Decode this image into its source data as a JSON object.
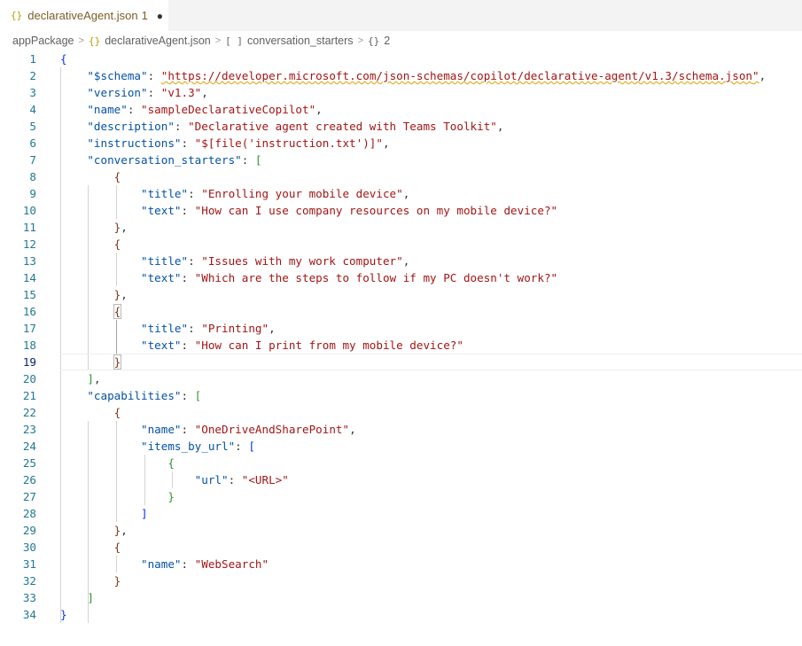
{
  "tab": {
    "icon": "{}",
    "filename": "declarativeAgent.json",
    "problem_count": "1",
    "modified_indicator": "●"
  },
  "breadcrumb": [
    {
      "icon": "",
      "label": "appPackage"
    },
    {
      "icon": "{}",
      "label": "declarativeAgent.json"
    },
    {
      "icon": "[ ]",
      "label": "conversation_starters"
    },
    {
      "icon": "{}",
      "label": "2"
    }
  ],
  "editor": {
    "current_line": 19,
    "lines": [
      {
        "n": "1",
        "t": [
          {
            "c": "b1",
            "v": "{"
          }
        ]
      },
      {
        "n": "2",
        "t": [
          {
            "c": "p",
            "v": "    "
          },
          {
            "c": "k",
            "v": "\"$schema\""
          },
          {
            "c": "p",
            "v": ": "
          },
          {
            "c": "s squig",
            "v": "\""
          },
          {
            "c": "s link squig",
            "v": "https://developer.microsoft.com/json-schemas/copilot/declarative-agent/v1.3/schema.json"
          },
          {
            "c": "s squig",
            "v": "\""
          },
          {
            "c": "p",
            "v": ","
          }
        ]
      },
      {
        "n": "3",
        "t": [
          {
            "c": "p",
            "v": "    "
          },
          {
            "c": "k",
            "v": "\"version\""
          },
          {
            "c": "p",
            "v": ": "
          },
          {
            "c": "s",
            "v": "\"v1.3\""
          },
          {
            "c": "p",
            "v": ","
          }
        ]
      },
      {
        "n": "4",
        "t": [
          {
            "c": "p",
            "v": "    "
          },
          {
            "c": "k",
            "v": "\"name\""
          },
          {
            "c": "p",
            "v": ": "
          },
          {
            "c": "s",
            "v": "\"sampleDeclarativeCopilot\""
          },
          {
            "c": "p",
            "v": ","
          }
        ]
      },
      {
        "n": "5",
        "t": [
          {
            "c": "p",
            "v": "    "
          },
          {
            "c": "k",
            "v": "\"description\""
          },
          {
            "c": "p",
            "v": ": "
          },
          {
            "c": "s",
            "v": "\"Declarative agent created with Teams Toolkit\""
          },
          {
            "c": "p",
            "v": ","
          }
        ]
      },
      {
        "n": "6",
        "t": [
          {
            "c": "p",
            "v": "    "
          },
          {
            "c": "k",
            "v": "\"instructions\""
          },
          {
            "c": "p",
            "v": ": "
          },
          {
            "c": "s",
            "v": "\"$[file('instruction.txt')]\""
          },
          {
            "c": "p",
            "v": ","
          }
        ]
      },
      {
        "n": "7",
        "t": [
          {
            "c": "p",
            "v": "    "
          },
          {
            "c": "k",
            "v": "\"conversation_starters\""
          },
          {
            "c": "p",
            "v": ": "
          },
          {
            "c": "b2",
            "v": "["
          }
        ]
      },
      {
        "n": "8",
        "t": [
          {
            "c": "p",
            "v": "        "
          },
          {
            "c": "b3",
            "v": "{"
          }
        ]
      },
      {
        "n": "9",
        "t": [
          {
            "c": "p",
            "v": "            "
          },
          {
            "c": "k",
            "v": "\"title\""
          },
          {
            "c": "p",
            "v": ": "
          },
          {
            "c": "s",
            "v": "\"Enrolling your mobile device\""
          },
          {
            "c": "p",
            "v": ","
          }
        ]
      },
      {
        "n": "10",
        "t": [
          {
            "c": "p",
            "v": "            "
          },
          {
            "c": "k",
            "v": "\"text\""
          },
          {
            "c": "p",
            "v": ": "
          },
          {
            "c": "s",
            "v": "\"How can I use company resources on my mobile device?\""
          }
        ]
      },
      {
        "n": "11",
        "t": [
          {
            "c": "p",
            "v": "        "
          },
          {
            "c": "b3",
            "v": "}"
          },
          {
            "c": "p",
            "v": ","
          }
        ]
      },
      {
        "n": "12",
        "t": [
          {
            "c": "p",
            "v": "        "
          },
          {
            "c": "b3",
            "v": "{"
          }
        ]
      },
      {
        "n": "13",
        "t": [
          {
            "c": "p",
            "v": "            "
          },
          {
            "c": "k",
            "v": "\"title\""
          },
          {
            "c": "p",
            "v": ": "
          },
          {
            "c": "s",
            "v": "\"Issues with my work computer\""
          },
          {
            "c": "p",
            "v": ","
          }
        ]
      },
      {
        "n": "14",
        "t": [
          {
            "c": "p",
            "v": "            "
          },
          {
            "c": "k",
            "v": "\"text\""
          },
          {
            "c": "p",
            "v": ": "
          },
          {
            "c": "s",
            "v": "\"Which are the steps to follow if my PC doesn't work?\""
          }
        ]
      },
      {
        "n": "15",
        "t": [
          {
            "c": "p",
            "v": "        "
          },
          {
            "c": "b3",
            "v": "}"
          },
          {
            "c": "p",
            "v": ","
          }
        ]
      },
      {
        "n": "16",
        "t": [
          {
            "c": "p",
            "v": "        "
          },
          {
            "c": "b3 boxed",
            "v": "{"
          }
        ]
      },
      {
        "n": "17",
        "t": [
          {
            "c": "p",
            "v": "            "
          },
          {
            "c": "k",
            "v": "\"title\""
          },
          {
            "c": "p",
            "v": ": "
          },
          {
            "c": "s",
            "v": "\"Printing\""
          },
          {
            "c": "p",
            "v": ","
          }
        ]
      },
      {
        "n": "18",
        "t": [
          {
            "c": "p",
            "v": "            "
          },
          {
            "c": "k",
            "v": "\"text\""
          },
          {
            "c": "p",
            "v": ": "
          },
          {
            "c": "s",
            "v": "\"How can I print from my mobile device?\""
          }
        ]
      },
      {
        "n": "19",
        "t": [
          {
            "c": "p",
            "v": "        "
          },
          {
            "c": "b3 boxed",
            "v": "}"
          }
        ]
      },
      {
        "n": "20",
        "t": [
          {
            "c": "p",
            "v": "    "
          },
          {
            "c": "b2",
            "v": "]"
          },
          {
            "c": "p",
            "v": ","
          }
        ]
      },
      {
        "n": "21",
        "t": [
          {
            "c": "p",
            "v": "    "
          },
          {
            "c": "k",
            "v": "\"capabilities\""
          },
          {
            "c": "p",
            "v": ": "
          },
          {
            "c": "b2",
            "v": "["
          }
        ]
      },
      {
        "n": "22",
        "t": [
          {
            "c": "p",
            "v": "        "
          },
          {
            "c": "b3",
            "v": "{"
          }
        ]
      },
      {
        "n": "23",
        "t": [
          {
            "c": "p",
            "v": "            "
          },
          {
            "c": "k",
            "v": "\"name\""
          },
          {
            "c": "p",
            "v": ": "
          },
          {
            "c": "s",
            "v": "\"OneDriveAndSharePoint\""
          },
          {
            "c": "p",
            "v": ","
          }
        ]
      },
      {
        "n": "24",
        "t": [
          {
            "c": "p",
            "v": "            "
          },
          {
            "c": "k",
            "v": "\"items_by_url\""
          },
          {
            "c": "p",
            "v": ": "
          },
          {
            "c": "b1",
            "v": "["
          }
        ]
      },
      {
        "n": "25",
        "t": [
          {
            "c": "p",
            "v": "                "
          },
          {
            "c": "b2",
            "v": "{"
          }
        ]
      },
      {
        "n": "26",
        "t": [
          {
            "c": "p",
            "v": "                    "
          },
          {
            "c": "k",
            "v": "\"url\""
          },
          {
            "c": "p",
            "v": ": "
          },
          {
            "c": "s",
            "v": "\"<URL>\""
          }
        ]
      },
      {
        "n": "27",
        "t": [
          {
            "c": "p",
            "v": "                "
          },
          {
            "c": "b2",
            "v": "}"
          }
        ]
      },
      {
        "n": "28",
        "t": [
          {
            "c": "p",
            "v": "            "
          },
          {
            "c": "b1",
            "v": "]"
          }
        ]
      },
      {
        "n": "29",
        "t": [
          {
            "c": "p",
            "v": "        "
          },
          {
            "c": "b3",
            "v": "}"
          },
          {
            "c": "p",
            "v": ","
          }
        ]
      },
      {
        "n": "30",
        "t": [
          {
            "c": "p",
            "v": "        "
          },
          {
            "c": "b3",
            "v": "{"
          }
        ]
      },
      {
        "n": "31",
        "t": [
          {
            "c": "p",
            "v": "            "
          },
          {
            "c": "k",
            "v": "\"name\""
          },
          {
            "c": "p",
            "v": ": "
          },
          {
            "c": "s",
            "v": "\"WebSearch\""
          }
        ]
      },
      {
        "n": "32",
        "t": [
          {
            "c": "p",
            "v": "        "
          },
          {
            "c": "b3",
            "v": "}"
          }
        ]
      },
      {
        "n": "33",
        "t": [
          {
            "c": "p",
            "v": "    "
          },
          {
            "c": "b2",
            "v": "]"
          }
        ]
      },
      {
        "n": "34",
        "t": [
          {
            "c": "b1",
            "v": "}"
          }
        ]
      }
    ]
  }
}
